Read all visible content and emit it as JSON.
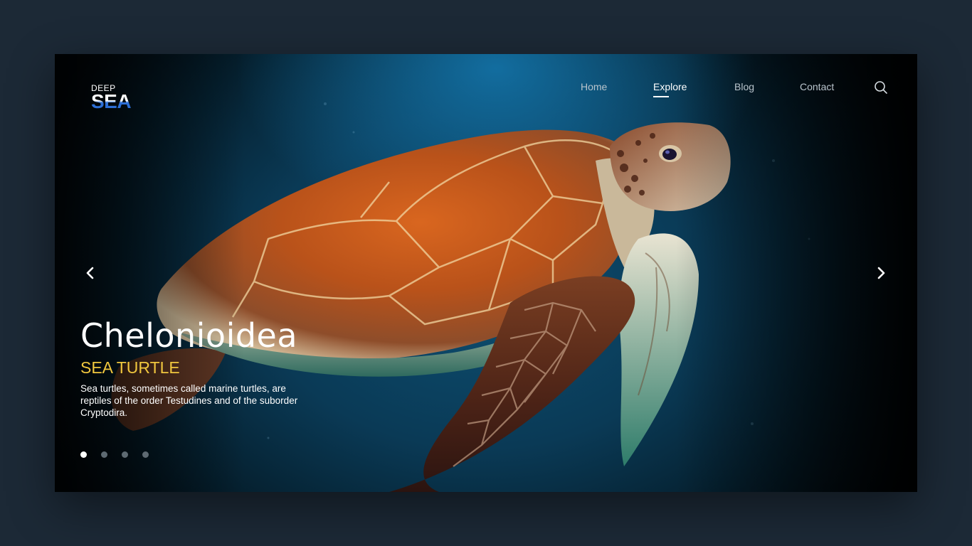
{
  "brand": {
    "top": "DEEP",
    "main": "SEA"
  },
  "nav": {
    "items": [
      {
        "label": "Home",
        "active": false
      },
      {
        "label": "Explore",
        "active": true
      },
      {
        "label": "Blog",
        "active": false
      },
      {
        "label": "Contact",
        "active": false
      }
    ],
    "search_icon": "search-icon"
  },
  "slider": {
    "prev_icon": "chevron-left-icon",
    "next_icon": "chevron-right-icon",
    "active_slide": 1,
    "slide_count": 4
  },
  "hero": {
    "title": "Chelonioidea",
    "subtitle": "SEA TURTLE",
    "description": "Sea turtles, sometimes called marine turtles, are reptiles of the order Testudines and of the suborder Cryptodira."
  },
  "colors": {
    "accent": "#f0c63e",
    "brand_blue": "#2d6fd6",
    "page_bg": "#1c2936"
  }
}
